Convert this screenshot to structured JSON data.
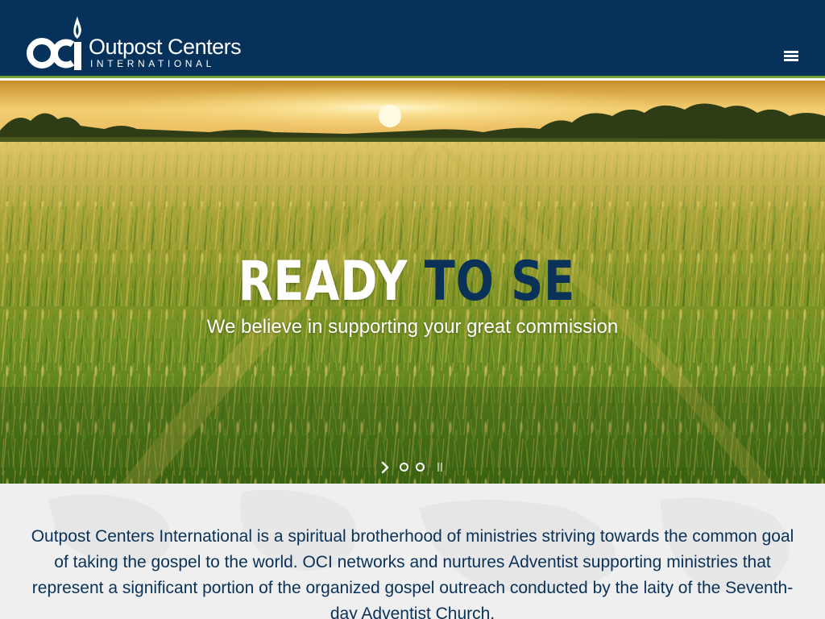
{
  "brand": {
    "name": "Outpost Centers",
    "tagline": "INTERNATIONAL",
    "logo_mark_text": "OCI"
  },
  "header": {
    "menu_icon": "hamburger-menu-icon"
  },
  "hero": {
    "headline_white": "READY",
    "headline_blue": "TO SE",
    "subheadline": "We believe in supporting your great commission",
    "slider": {
      "next_icon": "chevron-right-icon",
      "pause_icon": "pause-icon",
      "slide_count": 2
    }
  },
  "intro": {
    "paragraph": "Outpost Centers International is a spiritual brotherhood of ministries striving towards the common goal of taking the gospel to the world. OCI networks and nurtures Adventist supporting ministries that represent a significant portion of the organized gospel outreach conducted by the laity of the Seventh-day Adventist Church."
  },
  "colors": {
    "header_bg": "#05315a",
    "header_accent": "#6fa236",
    "headline_blue": "#0a3158",
    "intro_bg": "#efefef",
    "intro_text": "#0a3158"
  }
}
